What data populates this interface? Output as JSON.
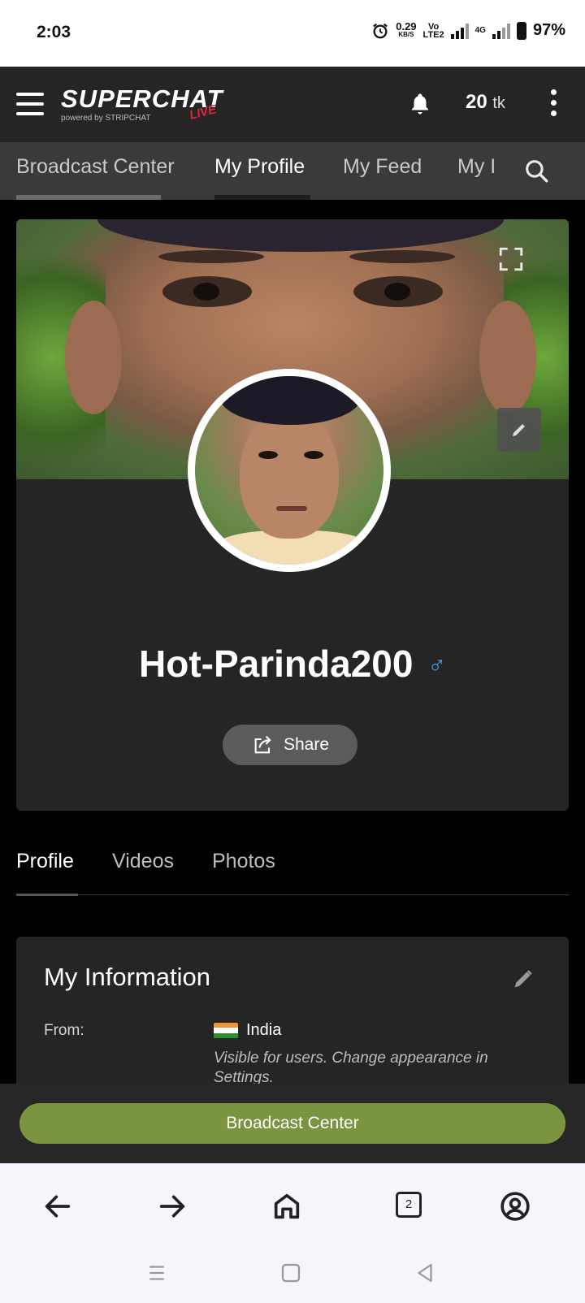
{
  "status_bar": {
    "time": "2:03",
    "speed_value": "0.29",
    "speed_unit": "KB/S",
    "volte_top": "Vo",
    "volte_bottom": "LTE2",
    "network": "4G",
    "battery": "97%"
  },
  "header": {
    "logo_text": "SUPERCHAT",
    "logo_live": "LIVE",
    "logo_sub": "powered by STRIPCHAT",
    "tokens_value": "20",
    "tokens_unit": "tk"
  },
  "nav_tabs": [
    {
      "label": "Broadcast Center"
    },
    {
      "label": "My Profile"
    },
    {
      "label": "My Feed"
    },
    {
      "label": "My I"
    }
  ],
  "profile": {
    "username": "Hot-Parinda200",
    "gender_symbol": "♂",
    "share_label": "Share"
  },
  "content_tabs": [
    {
      "label": "Profile"
    },
    {
      "label": "Videos"
    },
    {
      "label": "Photos"
    }
  ],
  "info": {
    "title": "My Information",
    "from_label": "From:",
    "from_value": "India",
    "hint": "Visible for users. Change appearance in Settings."
  },
  "bottom": {
    "broadcast_label": "Broadcast Center"
  },
  "browser": {
    "tab_count": "2"
  },
  "colors": {
    "accent_green": "#7a9440",
    "header_bg": "#252525",
    "tabs_bg": "#3a3a3a",
    "gender_blue": "#4aa3e8"
  }
}
